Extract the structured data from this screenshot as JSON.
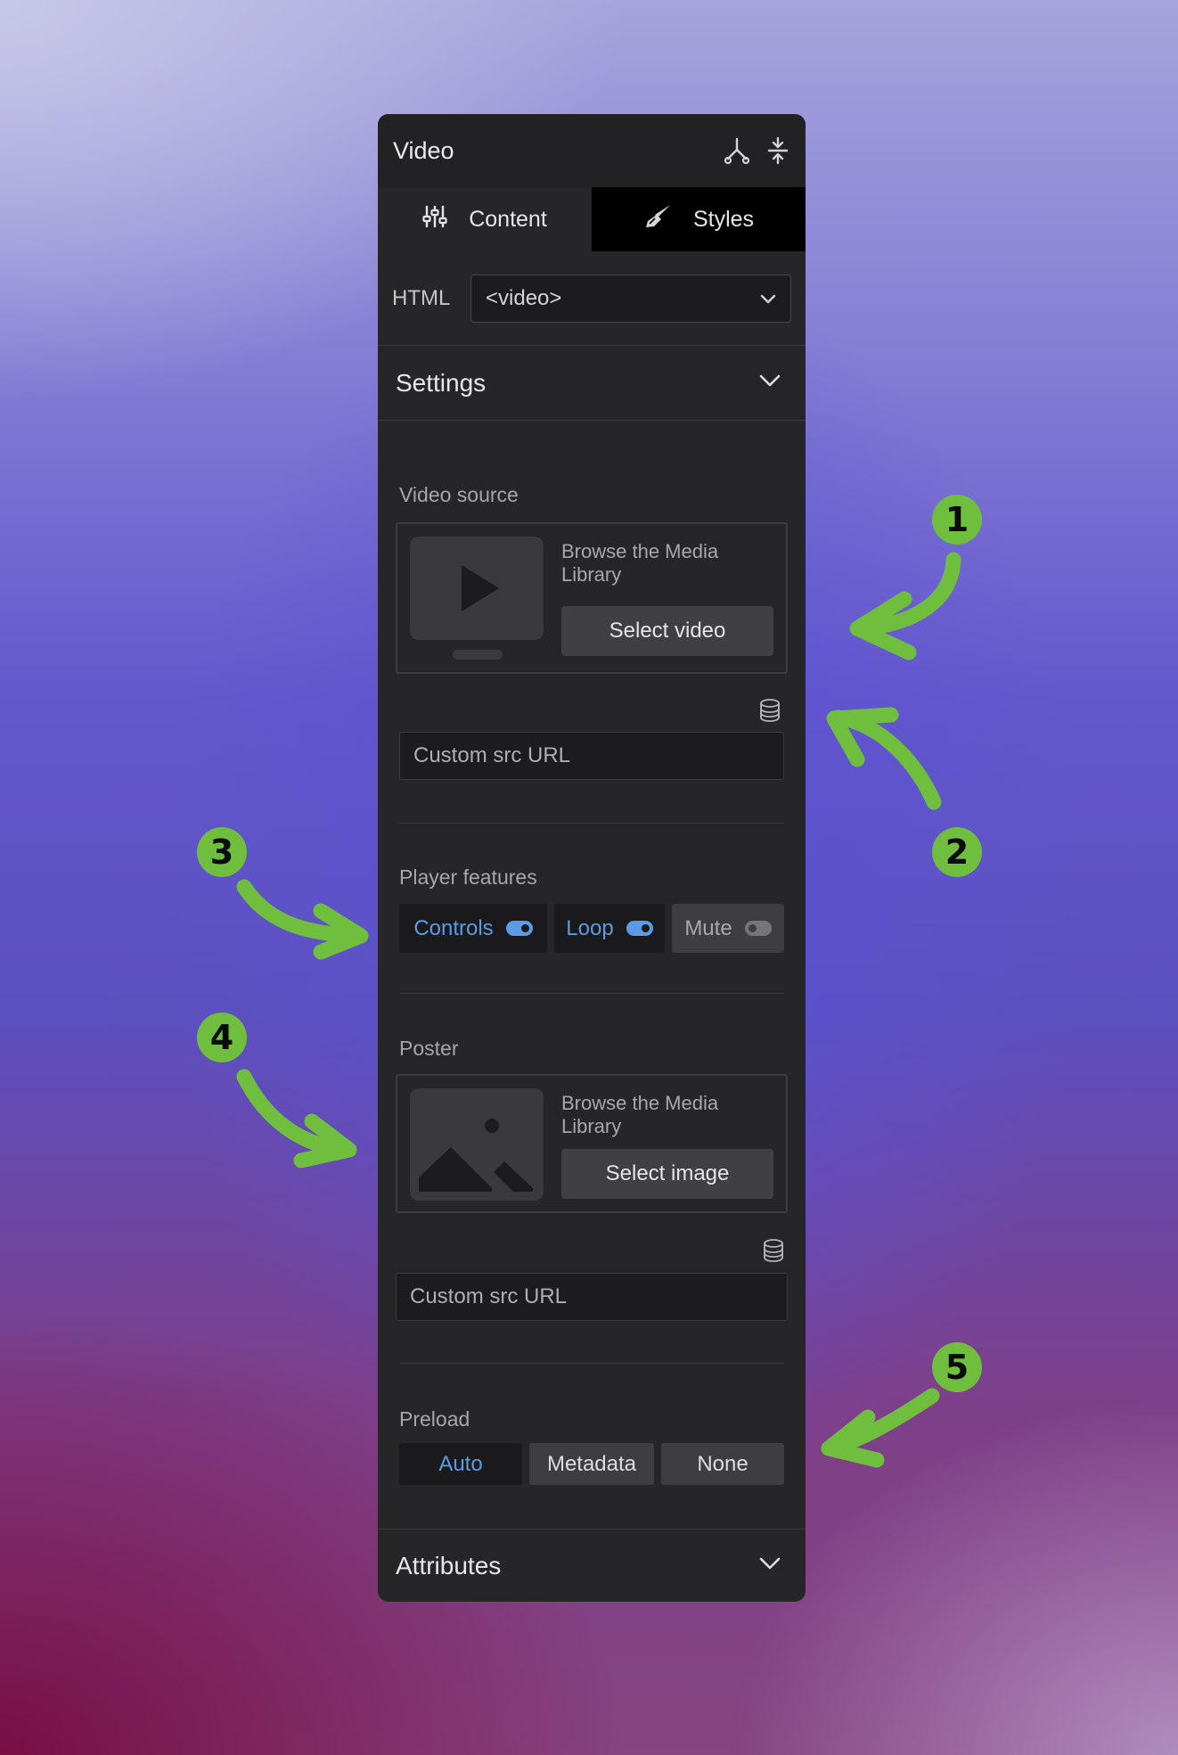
{
  "panel": {
    "title": "Video",
    "tabs": [
      {
        "label": "Content",
        "icon": "sliders-icon",
        "active": true
      },
      {
        "label": "Styles",
        "icon": "brush-icon",
        "active": false
      }
    ],
    "html_label": "HTML",
    "html_value": "<video>"
  },
  "settings": {
    "title": "Settings",
    "video_source": {
      "label": "Video source",
      "browse_text": "Browse the Media Library",
      "button": "Select video",
      "url_placeholder": "Custom src URL"
    },
    "player_features": {
      "label": "Player features",
      "items": [
        {
          "label": "Controls",
          "on": true
        },
        {
          "label": "Loop",
          "on": true
        },
        {
          "label": "Mute",
          "on": false
        }
      ]
    },
    "poster": {
      "label": "Poster",
      "browse_text": "Browse the Media Library",
      "button": "Select image",
      "url_placeholder": "Custom src URL"
    },
    "preload": {
      "label": "Preload",
      "options": [
        "Auto",
        "Metadata",
        "None"
      ],
      "selected": "Auto"
    }
  },
  "attributes": {
    "title": "Attributes"
  },
  "annotations": [
    "1",
    "2",
    "3",
    "4",
    "5"
  ],
  "colors": {
    "accent": "#5b9be6",
    "annotation": "#6fbe3e",
    "panel_bg": "#262629"
  }
}
